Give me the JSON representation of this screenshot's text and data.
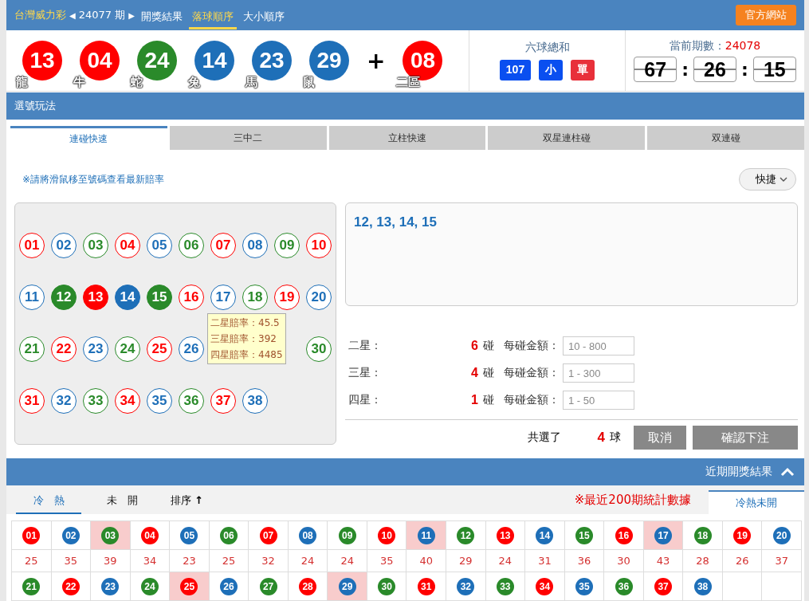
{
  "header": {
    "game": "台灣威力彩",
    "prev_arrow": "◀",
    "period": "24077 期",
    "next_arrow": "▶",
    "tabs": [
      {
        "label": "開獎結果",
        "selected": false
      },
      {
        "label": "落球順序",
        "selected": true
      },
      {
        "label": "大小順序",
        "selected": false
      }
    ],
    "official_button": "官方網站"
  },
  "draw": {
    "balls": [
      {
        "number": "13",
        "color": "#ff0000",
        "zodiac": "龍"
      },
      {
        "number": "04",
        "color": "#ff0000",
        "zodiac": "牛"
      },
      {
        "number": "24",
        "color": "#2a8a2a",
        "zodiac": "蛇"
      },
      {
        "number": "14",
        "color": "#1e6fb8",
        "zodiac": "兔"
      },
      {
        "number": "23",
        "color": "#1e6fb8",
        "zodiac": "馬"
      },
      {
        "number": "29",
        "color": "#1e6fb8",
        "zodiac": "鼠"
      }
    ],
    "plus": "+",
    "special": {
      "number": "08",
      "color": "#ff0000",
      "zodiac": "二區"
    }
  },
  "sum": {
    "title": "六球總和",
    "total": "107",
    "size": "小",
    "parity": "單"
  },
  "countdown": {
    "label": "當前期數：",
    "period": "24078",
    "parts": [
      "67",
      "26",
      "15"
    ],
    "separator": ":"
  },
  "section_title": "選號玩法",
  "play_tabs": [
    {
      "label": "連碰快速",
      "selected": true
    },
    {
      "label": "三中二",
      "selected": false
    },
    {
      "label": "立柱快速",
      "selected": false
    },
    {
      "label": "双星連柱碰",
      "selected": false
    },
    {
      "label": "双連碰",
      "selected": false
    }
  ],
  "hint": "※請將滑鼠移至號碼查看最新賠率",
  "quick_button": "快捷",
  "picker": [
    {
      "kind": "ball",
      "number": "01",
      "color": "#ff0000",
      "selected": false
    },
    {
      "kind": "ball",
      "number": "02",
      "color": "#1e6fb8",
      "selected": false
    },
    {
      "kind": "ball",
      "number": "03",
      "color": "#2a8a2a",
      "selected": false
    },
    {
      "kind": "ball",
      "number": "04",
      "color": "#ff0000",
      "selected": false
    },
    {
      "kind": "ball",
      "number": "05",
      "color": "#1e6fb8",
      "selected": false
    },
    {
      "kind": "ball",
      "number": "06",
      "color": "#2a8a2a",
      "selected": false
    },
    {
      "kind": "ball",
      "number": "07",
      "color": "#ff0000",
      "selected": false
    },
    {
      "kind": "ball",
      "number": "08",
      "color": "#1e6fb8",
      "selected": false
    },
    {
      "kind": "ball",
      "number": "09",
      "color": "#2a8a2a",
      "selected": false
    },
    {
      "kind": "ball",
      "number": "10",
      "color": "#ff0000",
      "selected": false
    },
    {
      "kind": "ball",
      "number": "11",
      "color": "#1e6fb8",
      "selected": false
    },
    {
      "kind": "ball",
      "number": "12",
      "color": "#2a8a2a",
      "selected": true
    },
    {
      "kind": "ball",
      "number": "13",
      "color": "#ff0000",
      "selected": true
    },
    {
      "kind": "ball",
      "number": "14",
      "color": "#1e6fb8",
      "selected": true
    },
    {
      "kind": "ball",
      "number": "15",
      "color": "#2a8a2a",
      "selected": true
    },
    {
      "kind": "ball",
      "number": "16",
      "color": "#ff0000",
      "selected": false
    },
    {
      "kind": "ball",
      "number": "17",
      "color": "#1e6fb8",
      "selected": false
    },
    {
      "kind": "ball",
      "number": "18",
      "color": "#2a8a2a",
      "selected": false
    },
    {
      "kind": "ball",
      "number": "19",
      "color": "#ff0000",
      "selected": false
    },
    {
      "kind": "ball",
      "number": "20",
      "color": "#1e6fb8",
      "selected": false
    },
    {
      "kind": "ball",
      "number": "21",
      "color": "#2a8a2a",
      "selected": false
    },
    {
      "kind": "ball",
      "number": "22",
      "color": "#ff0000",
      "selected": false
    },
    {
      "kind": "ball",
      "number": "23",
      "color": "#1e6fb8",
      "selected": false
    },
    {
      "kind": "ball",
      "number": "24",
      "color": "#2a8a2a",
      "selected": false
    },
    {
      "kind": "ball",
      "number": "25",
      "color": "#ff0000",
      "selected": false
    },
    {
      "kind": "ball",
      "number": "26",
      "color": "#1e6fb8",
      "selected": false
    },
    {
      "kind": "covered"
    },
    {
      "kind": "covered"
    },
    {
      "kind": "covered"
    },
    {
      "kind": "ball",
      "number": "30",
      "color": "#2a8a2a",
      "selected": false
    },
    {
      "kind": "ball",
      "number": "31",
      "color": "#ff0000",
      "selected": false
    },
    {
      "kind": "ball",
      "number": "32",
      "color": "#1e6fb8",
      "selected": false
    },
    {
      "kind": "ball",
      "number": "33",
      "color": "#2a8a2a",
      "selected": false
    },
    {
      "kind": "ball",
      "number": "34",
      "color": "#ff0000",
      "selected": false
    },
    {
      "kind": "ball",
      "number": "35",
      "color": "#1e6fb8",
      "selected": false
    },
    {
      "kind": "ball",
      "number": "36",
      "color": "#2a8a2a",
      "selected": false
    },
    {
      "kind": "ball",
      "number": "37",
      "color": "#ff0000",
      "selected": false
    },
    {
      "kind": "ball",
      "number": "38",
      "color": "#1e6fb8",
      "selected": false
    }
  ],
  "tooltip": [
    "二星賠率：45.5",
    "三星賠率：392",
    "四星賠率：4485"
  ],
  "selection": "12, 13, 14, 15",
  "bets": [
    {
      "label": "二星：",
      "count": "6",
      "unit": "碰",
      "amount_label": "每碰金額：",
      "placeholder": "10 - 800"
    },
    {
      "label": "三星：",
      "count": "4",
      "unit": "碰",
      "amount_label": "每碰金額：",
      "placeholder": "1 - 300"
    },
    {
      "label": "四星：",
      "count": "1",
      "unit": "碰",
      "amount_label": "每碰金額：",
      "placeholder": "1 - 50"
    }
  ],
  "total": {
    "label": "共選了",
    "count": "4",
    "unit": "球"
  },
  "buttons": {
    "cancel": "取消",
    "confirm": "確認下注"
  },
  "recent_title": "近期開獎結果",
  "stat_tabs": [
    {
      "label": "冷　熱",
      "selected": true
    },
    {
      "label": "未　開",
      "selected": false
    }
  ],
  "sort": "排序",
  "sort_arrow": "↑",
  "stat_note": "※最近200期統計數據",
  "stat_side_tab": "冷熱未開",
  "stats": [
    {
      "number": "01",
      "color": "#ff0000",
      "count": "25",
      "highlighted": false
    },
    {
      "number": "02",
      "color": "#1e6fb8",
      "count": "35",
      "highlighted": false
    },
    {
      "number": "03",
      "color": "#2a8a2a",
      "count": "39",
      "highlighted": true
    },
    {
      "number": "04",
      "color": "#ff0000",
      "count": "34",
      "highlighted": false
    },
    {
      "number": "05",
      "color": "#1e6fb8",
      "count": "23",
      "highlighted": false
    },
    {
      "number": "06",
      "color": "#2a8a2a",
      "count": "25",
      "highlighted": false
    },
    {
      "number": "07",
      "color": "#ff0000",
      "count": "32",
      "highlighted": false
    },
    {
      "number": "08",
      "color": "#1e6fb8",
      "count": "24",
      "highlighted": false
    },
    {
      "number": "09",
      "color": "#2a8a2a",
      "count": "24",
      "highlighted": false
    },
    {
      "number": "10",
      "color": "#ff0000",
      "count": "35",
      "highlighted": false
    },
    {
      "number": "11",
      "color": "#1e6fb8",
      "count": "40",
      "highlighted": true
    },
    {
      "number": "12",
      "color": "#2a8a2a",
      "count": "29",
      "highlighted": false
    },
    {
      "number": "13",
      "color": "#ff0000",
      "count": "24",
      "highlighted": false
    },
    {
      "number": "14",
      "color": "#1e6fb8",
      "count": "31",
      "highlighted": false
    },
    {
      "number": "15",
      "color": "#2a8a2a",
      "count": "36",
      "highlighted": false
    },
    {
      "number": "16",
      "color": "#ff0000",
      "count": "30",
      "highlighted": false
    },
    {
      "number": "17",
      "color": "#1e6fb8",
      "count": "43",
      "highlighted": true
    },
    {
      "number": "18",
      "color": "#2a8a2a",
      "count": "28",
      "highlighted": false
    },
    {
      "number": "19",
      "color": "#ff0000",
      "count": "26",
      "highlighted": false
    },
    {
      "number": "20",
      "color": "#1e6fb8",
      "count": "37",
      "highlighted": false
    },
    {
      "number": "21",
      "color": "#2a8a2a",
      "highlighted": false
    },
    {
      "number": "22",
      "color": "#ff0000",
      "highlighted": false
    },
    {
      "number": "23",
      "color": "#1e6fb8",
      "highlighted": false
    },
    {
      "number": "24",
      "color": "#2a8a2a",
      "highlighted": false
    },
    {
      "number": "25",
      "color": "#ff0000",
      "highlighted": true
    },
    {
      "number": "26",
      "color": "#1e6fb8",
      "highlighted": false
    },
    {
      "number": "27",
      "color": "#2a8a2a",
      "highlighted": false
    },
    {
      "number": "28",
      "color": "#ff0000",
      "highlighted": false
    },
    {
      "number": "29",
      "color": "#1e6fb8",
      "highlighted": true
    },
    {
      "number": "30",
      "color": "#2a8a2a",
      "highlighted": false
    },
    {
      "number": "31",
      "color": "#ff0000",
      "highlighted": false
    },
    {
      "number": "32",
      "color": "#1e6fb8",
      "highlighted": false
    },
    {
      "number": "33",
      "color": "#2a8a2a",
      "highlighted": false
    },
    {
      "number": "34",
      "color": "#ff0000",
      "highlighted": false
    },
    {
      "number": "35",
      "color": "#1e6fb8",
      "highlighted": false
    },
    {
      "number": "36",
      "color": "#2a8a2a",
      "highlighted": false
    },
    {
      "number": "37",
      "color": "#ff0000",
      "highlighted": false
    },
    {
      "number": "38",
      "color": "#1e6fb8",
      "highlighted": false
    }
  ]
}
